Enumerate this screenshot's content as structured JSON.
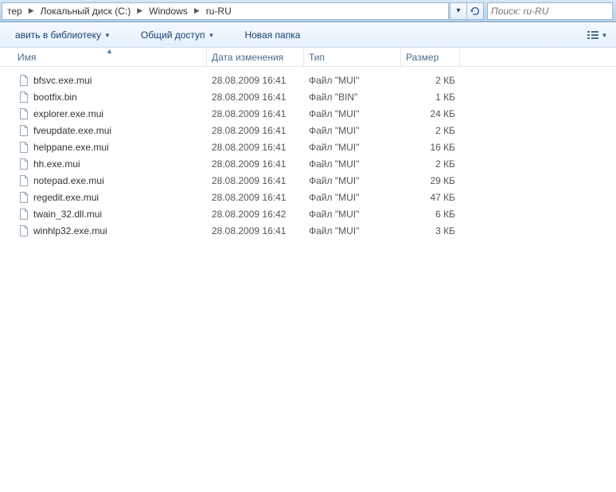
{
  "breadcrumb": {
    "items": [
      "тер",
      "Локальный диск (C:)",
      "Windows",
      "ru-RU"
    ]
  },
  "search": {
    "placeholder": "Поиск: ru-RU"
  },
  "toolbar": {
    "library_label": "авить в библиотеку",
    "share_label": "Общий доступ",
    "new_folder_label": "Новая папка"
  },
  "columns": {
    "name": "Имя",
    "date": "Дата изменения",
    "type": "Тип",
    "size": "Размер",
    "sorted": "name"
  },
  "files": [
    {
      "name": "bfsvc.exe.mui",
      "date": "28.08.2009 16:41",
      "type": "Файл \"MUI\"",
      "size": "2 КБ"
    },
    {
      "name": "bootfix.bin",
      "date": "28.08.2009 16:41",
      "type": "Файл \"BIN\"",
      "size": "1 КБ"
    },
    {
      "name": "explorer.exe.mui",
      "date": "28.08.2009 16:41",
      "type": "Файл \"MUI\"",
      "size": "24 КБ"
    },
    {
      "name": "fveupdate.exe.mui",
      "date": "28.08.2009 16:41",
      "type": "Файл \"MUI\"",
      "size": "2 КБ"
    },
    {
      "name": "helppane.exe.mui",
      "date": "28.08.2009 16:41",
      "type": "Файл \"MUI\"",
      "size": "16 КБ"
    },
    {
      "name": "hh.exe.mui",
      "date": "28.08.2009 16:41",
      "type": "Файл \"MUI\"",
      "size": "2 КБ"
    },
    {
      "name": "notepad.exe.mui",
      "date": "28.08.2009 16:41",
      "type": "Файл \"MUI\"",
      "size": "29 КБ"
    },
    {
      "name": "regedit.exe.mui",
      "date": "28.08.2009 16:41",
      "type": "Файл \"MUI\"",
      "size": "47 КБ"
    },
    {
      "name": "twain_32.dll.mui",
      "date": "28.08.2009 16:42",
      "type": "Файл \"MUI\"",
      "size": "6 КБ"
    },
    {
      "name": "winhlp32.exe.mui",
      "date": "28.08.2009 16:41",
      "type": "Файл \"MUI\"",
      "size": "3 КБ"
    }
  ]
}
